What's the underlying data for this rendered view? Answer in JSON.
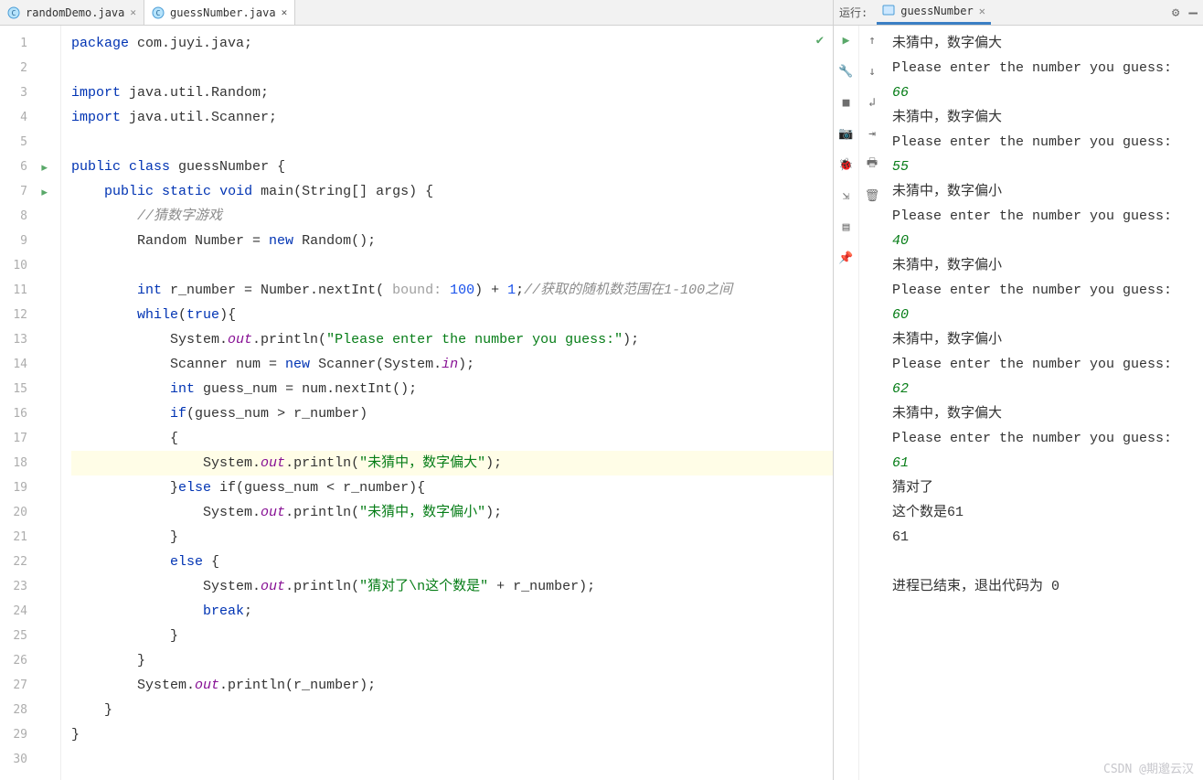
{
  "tabs": [
    {
      "label": "randomDemo.java",
      "active": false
    },
    {
      "label": "guessNumber.java",
      "active": true
    }
  ],
  "gutter": {
    "lines": [
      "1",
      "2",
      "3",
      "4",
      "5",
      "6",
      "7",
      "8",
      "9",
      "10",
      "11",
      "12",
      "13",
      "14",
      "15",
      "16",
      "17",
      "18",
      "19",
      "20",
      "21",
      "22",
      "23",
      "24",
      "25",
      "26",
      "27",
      "28",
      "29",
      "30"
    ],
    "run_markers": [
      6,
      7
    ]
  },
  "code": {
    "kw_package": "package",
    "pkg_name": " com.juyi.java;",
    "kw_import": "import",
    "import1": " java.util.Random;",
    "import2": " java.util.Scanner;",
    "kw_public": "public",
    "kw_class": "class",
    "cls_name": " guessNumber {",
    "kw_static": "static",
    "kw_void": "void",
    "main_name": "main",
    "main_sig": "(String[] args) {",
    "cmt_game": "//猜数字游戏",
    "rand_decl_a": "Random Number = ",
    "kw_new": "new",
    "rand_decl_b": " Random();",
    "kw_int": "int",
    "rnum_a": " r_number = Number.nextInt( ",
    "param_bound": "bound:",
    "num_100": " 100",
    "rnum_b": ") + ",
    "num_1": "1",
    "rnum_c": ";",
    "cmt_range": "//获取的随机数范围在1-100之间",
    "kw_while": "while",
    "while_a": "(",
    "kw_true": "true",
    "while_b": "){",
    "sys": "System.",
    "out": "out",
    "println": ".println(",
    "str_prompt": "\"Please enter the number you guess:\"",
    "close_paren": ");",
    "scanner_a": "Scanner num = ",
    "scanner_b": " Scanner(System.",
    "in": "in",
    "scanner_c": ");",
    "guess_decl": " guess_num = num.nextInt();",
    "kw_if": "if",
    "if_cond": "(guess_num > r_number)",
    "brace_open": "{",
    "str_big": "\"未猜中，数字偏大\"",
    "brace_close": "}",
    "kw_else": "else",
    "elseif_cond": " if(guess_num < r_number){",
    "str_small": "\"未猜中，数字偏小\"",
    "else_open": " {",
    "str_right": "\"猜对了\\n这个数是\"",
    "plus_r": " + r_number);",
    "kw_break": "break",
    "semi": ";",
    "print_r": "System.",
    "print_r2": ".println(r_number);"
  },
  "run": {
    "label": "运行:",
    "tab": "guessNumber",
    "lines": [
      {
        "t": "plain",
        "v": "未猜中，数字偏大"
      },
      {
        "t": "plain",
        "v": "Please enter the number you guess:"
      },
      {
        "t": "input",
        "v": "66"
      },
      {
        "t": "plain",
        "v": "未猜中，数字偏大"
      },
      {
        "t": "plain",
        "v": "Please enter the number you guess:"
      },
      {
        "t": "input",
        "v": "55"
      },
      {
        "t": "plain",
        "v": "未猜中，数字偏小"
      },
      {
        "t": "plain",
        "v": "Please enter the number you guess:"
      },
      {
        "t": "input",
        "v": "40"
      },
      {
        "t": "plain",
        "v": "未猜中，数字偏小"
      },
      {
        "t": "plain",
        "v": "Please enter the number you guess:"
      },
      {
        "t": "input",
        "v": "60"
      },
      {
        "t": "plain",
        "v": "未猜中，数字偏小"
      },
      {
        "t": "plain",
        "v": "Please enter the number you guess:"
      },
      {
        "t": "input",
        "v": "62"
      },
      {
        "t": "plain",
        "v": "未猜中，数字偏大"
      },
      {
        "t": "plain",
        "v": "Please enter the number you guess:"
      },
      {
        "t": "input",
        "v": "61"
      },
      {
        "t": "plain",
        "v": "猜对了"
      },
      {
        "t": "plain",
        "v": "这个数是61"
      },
      {
        "t": "plain",
        "v": "61"
      },
      {
        "t": "blank",
        "v": ""
      },
      {
        "t": "exit",
        "v": "进程已结束，退出代码为 0"
      }
    ]
  },
  "watermark": "CSDN @期邈云汉",
  "icons": {
    "play": "▶",
    "wrench": "🔧",
    "stop": "■",
    "camera": "📷",
    "bug": "🐞",
    "exit": "↘",
    "layout": "▤",
    "pin": "📌",
    "up": "↑",
    "down": "↓",
    "wrap": "↲",
    "soft": "⇥",
    "print": "🖶",
    "trash": "🗑"
  }
}
